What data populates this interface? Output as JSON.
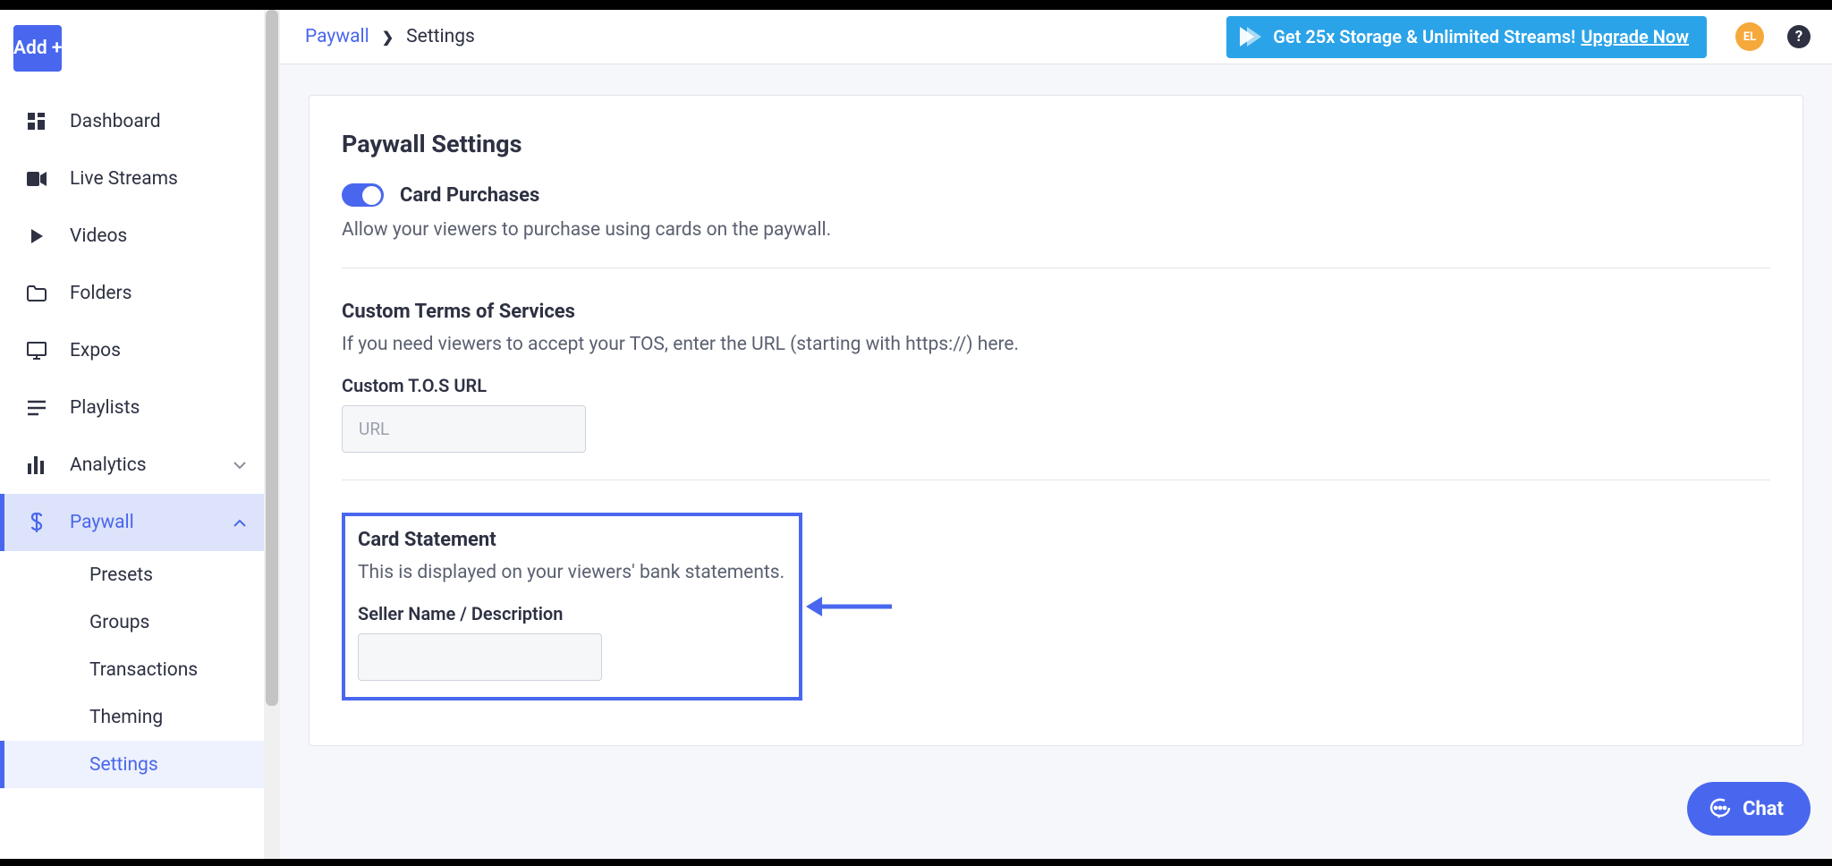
{
  "sidebar": {
    "add_label": "Add +",
    "items": [
      {
        "label": "Dashboard"
      },
      {
        "label": "Live Streams"
      },
      {
        "label": "Videos"
      },
      {
        "label": "Folders"
      },
      {
        "label": "Expos"
      },
      {
        "label": "Playlists"
      },
      {
        "label": "Analytics"
      },
      {
        "label": "Paywall"
      }
    ],
    "paywall_sub": [
      {
        "label": "Presets"
      },
      {
        "label": "Groups"
      },
      {
        "label": "Transactions"
      },
      {
        "label": "Theming"
      },
      {
        "label": "Settings"
      }
    ]
  },
  "breadcrumb": {
    "parent": "Paywall",
    "sep": "❯",
    "current": "Settings"
  },
  "promo": {
    "text": "Get 25x Storage & Unlimited Streams! ",
    "link": "Upgrade Now"
  },
  "avatar": "EL",
  "help": "?",
  "page": {
    "title": "Paywall Settings",
    "card_purchases": {
      "label": "Card Purchases",
      "desc": "Allow your viewers to purchase using cards on the paywall."
    },
    "tos": {
      "heading": "Custom Terms of Services",
      "desc": "If you need viewers to accept your TOS, enter the URL (starting with https://) here.",
      "field_label": "Custom T.O.S URL",
      "placeholder": "URL",
      "value": ""
    },
    "statement": {
      "heading": "Card Statement",
      "desc": "This is displayed on your viewers' bank statements.",
      "field_label": "Seller Name / Description",
      "value": ""
    }
  },
  "chat": "Chat"
}
